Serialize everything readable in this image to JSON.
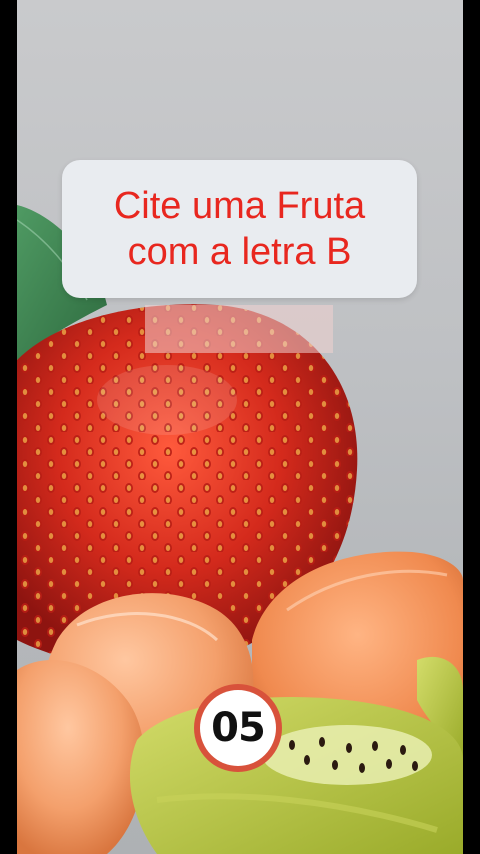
{
  "prompt": {
    "line1": "Cite uma Fruta",
    "line2": "com a letra B"
  },
  "counter": {
    "number": "05"
  },
  "colors": {
    "prompt_text": "#e8271f",
    "caption_bg": "#e9ecf0",
    "counter_ring": "#d8523b",
    "strawberry": "#d42a1c",
    "tangerine": "#f4a06c",
    "kiwi": "#b7c43a"
  }
}
